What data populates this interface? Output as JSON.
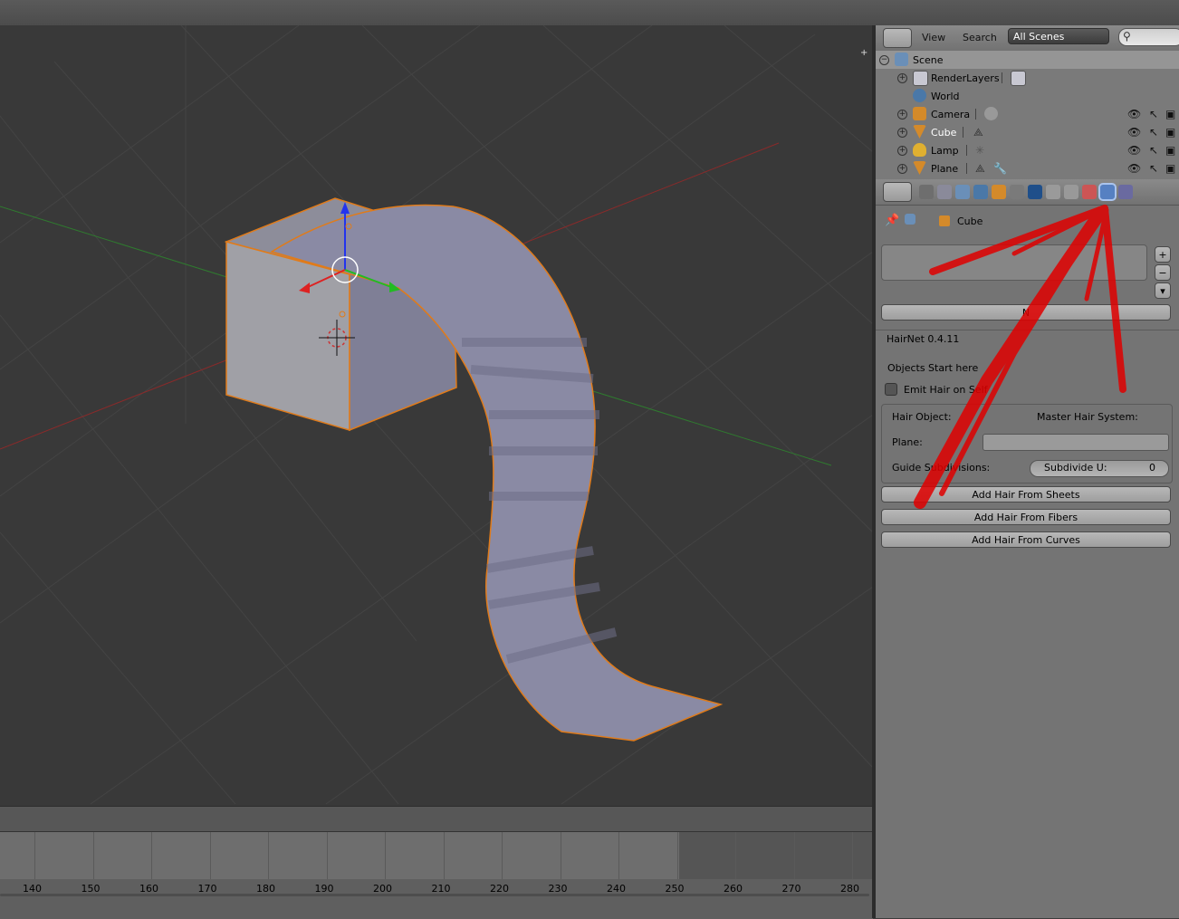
{
  "outliner": {
    "menu_view": "View",
    "menu_search": "Search",
    "scene_filter": "All Scenes",
    "rows": [
      {
        "label": "Scene"
      },
      {
        "label": "RenderLayers"
      },
      {
        "label": "World"
      },
      {
        "label": "Camera"
      },
      {
        "label": "Cube"
      },
      {
        "label": "Lamp"
      },
      {
        "label": "Plane"
      }
    ]
  },
  "properties": {
    "breadcrumb_object": "Cube",
    "new_button": "N",
    "panel_title": "HairNet 0.4.11",
    "objects_start": "Objects Start here",
    "emit_checkbox": "Emit Hair on Self",
    "hair_object_label": "Hair Object:",
    "master_hair_label": "Master Hair System:",
    "plane_label": "Plane:",
    "guide_label": "Guide Subdivisions:",
    "subdivide_label": "Subdivide U:",
    "subdivide_value": "0",
    "btn_sheets": "Add Hair From Sheets",
    "btn_fibers": "Add Hair From Fibers",
    "btn_curves": "Add Hair From Curves"
  },
  "timeline": {
    "ticks": [
      "140",
      "150",
      "160",
      "170",
      "180",
      "190",
      "200",
      "210",
      "220",
      "230",
      "240",
      "250",
      "260",
      "270",
      "280"
    ]
  },
  "colors": {
    "selection_orange": "#e07b1a",
    "annotation_red": "#e00000",
    "active_tab_blue": "#5680c2"
  },
  "icons": [
    "outliner-display-icon",
    "search-icon",
    "scene-icon",
    "renderlayers-icon",
    "world-icon",
    "camera-icon",
    "mesh-icon",
    "lamp-icon",
    "eye-icon",
    "cursor-icon",
    "render-icon",
    "pin-icon",
    "wrench-icon",
    "plus-icon",
    "minus-icon"
  ]
}
